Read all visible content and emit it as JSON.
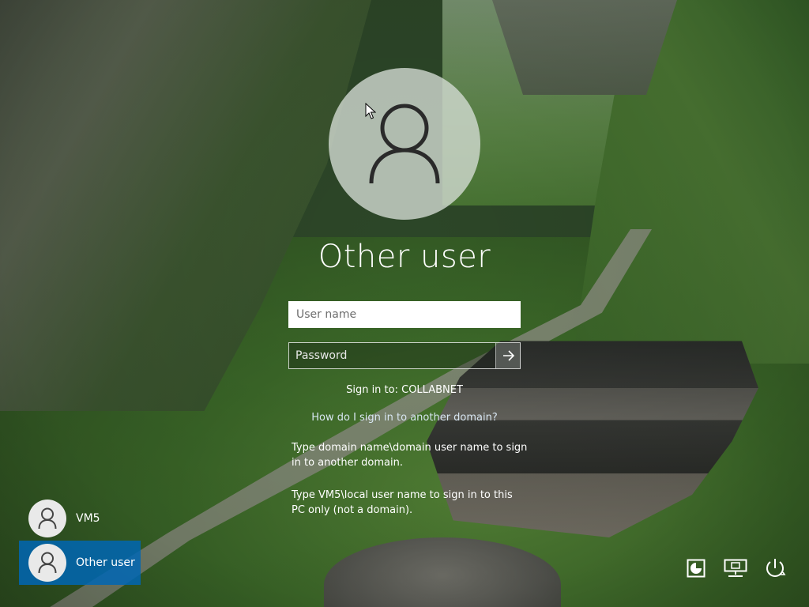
{
  "login": {
    "heading": "Other user",
    "username_placeholder": "User name",
    "password_placeholder": "Password",
    "sign_in_to": "Sign in to: COLLABNET",
    "help_link": "How do I sign in to another domain?",
    "help_text_1": "Type domain name\\domain user name to sign in to another domain.",
    "help_text_2": "Type VM5\\local user name to sign in to this PC only (not a domain)."
  },
  "users": [
    {
      "name": "VM5",
      "selected": false
    },
    {
      "name": "Other user",
      "selected": true
    }
  ],
  "controls": {
    "icons": [
      "ease-of-access-icon",
      "network-icon",
      "power-icon"
    ]
  },
  "colors": {
    "selected_user_bg": "#0066b4",
    "text": "#ffffff"
  }
}
